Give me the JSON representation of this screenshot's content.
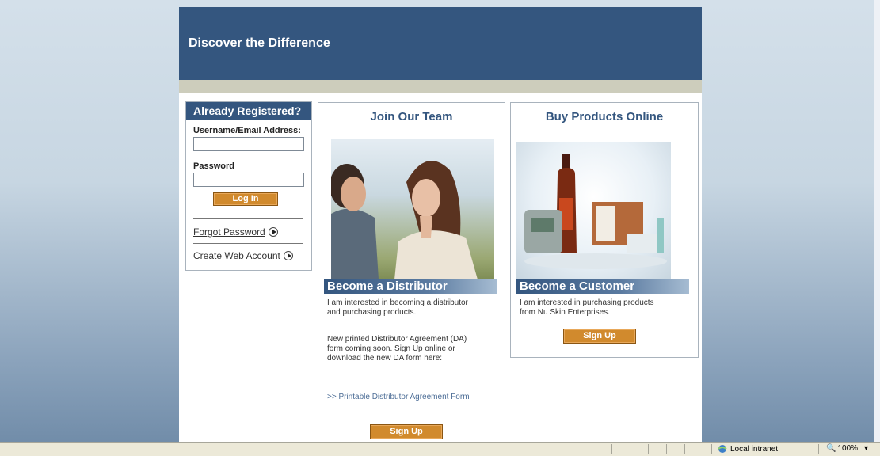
{
  "header": {
    "title": "Discover the Difference"
  },
  "login": {
    "heading": "Already Registered?",
    "username_label": "Username/Email Address:",
    "username_value": "",
    "password_label": "Password",
    "password_value": "",
    "login_button": "Log In",
    "forgot_password": "Forgot Password",
    "create_account": "Create Web Account"
  },
  "join": {
    "title": "Join Our Team",
    "band": "Become a Distributor",
    "text1": "I am interested in becoming a distributor and purchasing products.",
    "text2": "New printed Distributor Agreement (DA) form coming soon. Sign Up online or download the new DA form here:",
    "link": ">> Printable Distributor Agreement Form",
    "signup": "Sign Up"
  },
  "buy": {
    "title": "Buy Products Online",
    "band": "Become a Customer",
    "text1": "I am interested in purchasing products from Nu Skin Enterprises.",
    "signup": "Sign Up"
  },
  "statusbar": {
    "zone": "Local intranet",
    "zoom": "100%"
  },
  "colors": {
    "header_blue": "#34567f",
    "button_orange": "#d18a2d",
    "strip_tan": "#cdcdbc"
  }
}
